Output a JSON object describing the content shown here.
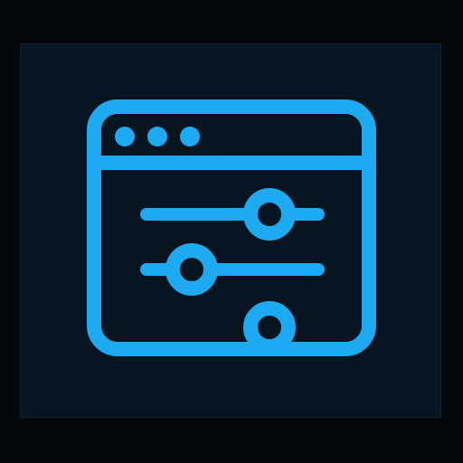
{
  "icon": {
    "name": "browser-settings-sliders-icon",
    "color": "#1eaaf0",
    "background": "#03080d",
    "panel_background": "#071520",
    "window_dots": 3,
    "sliders": [
      {
        "name": "slider-1",
        "level": 0.69
      },
      {
        "name": "slider-2",
        "level": 0.28
      },
      {
        "name": "slider-3",
        "level": 0.69
      }
    ]
  }
}
